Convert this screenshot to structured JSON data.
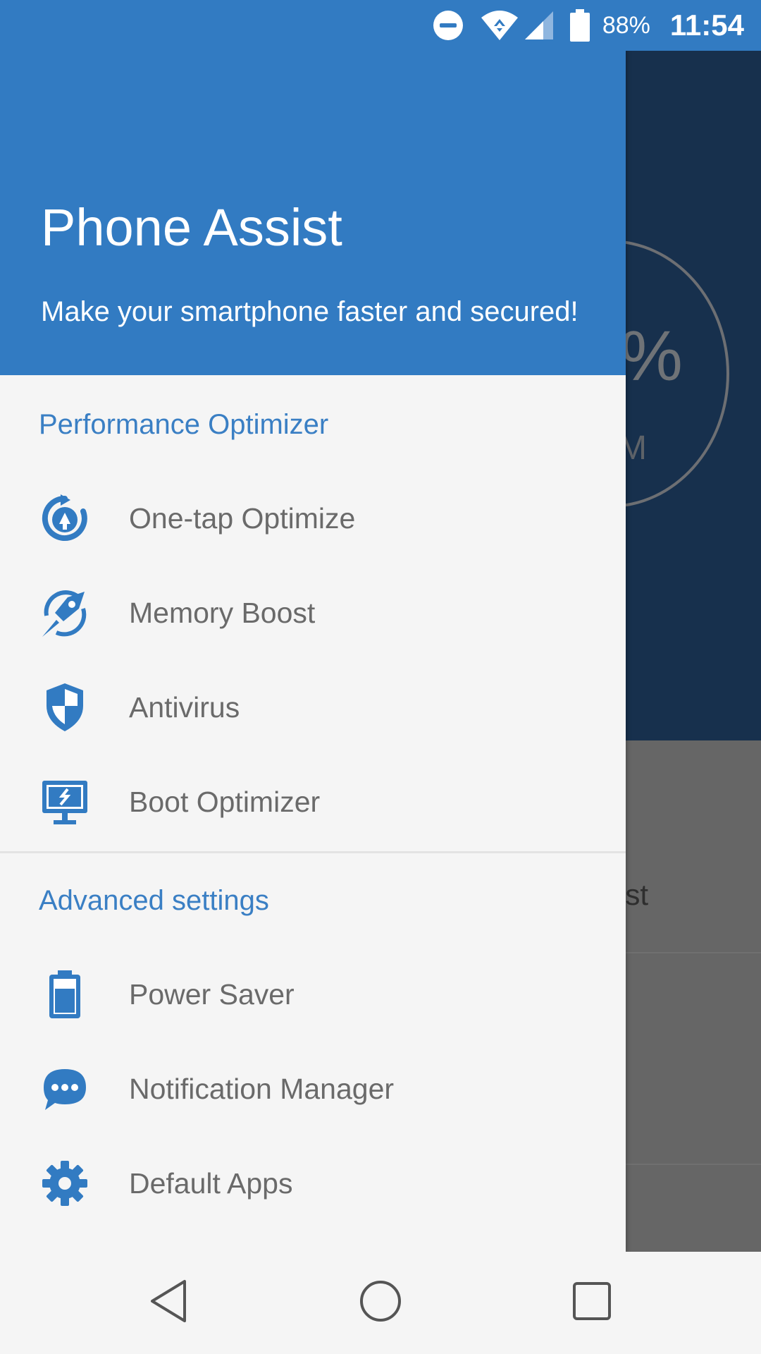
{
  "status_bar": {
    "battery_percent": "88%",
    "time": "11:54",
    "icons": [
      "do-not-disturb-icon",
      "wifi-icon",
      "cell-signal-icon",
      "battery-icon"
    ]
  },
  "background_app": {
    "ring_value_fragment": "%",
    "ring_unit_fragment": "M",
    "card_label_fragment": "ost"
  },
  "drawer": {
    "title": "Phone Assist",
    "subtitle": "Make your smartphone faster and secured!",
    "sections": [
      {
        "title": "Performance Optimizer",
        "items": [
          {
            "label": "One-tap Optimize",
            "icon": "optimize-icon"
          },
          {
            "label": "Memory Boost",
            "icon": "rocket-icon"
          },
          {
            "label": "Antivirus",
            "icon": "shield-icon"
          },
          {
            "label": "Boot Optimizer",
            "icon": "monitor-icon"
          }
        ]
      },
      {
        "title": "Advanced settings",
        "items": [
          {
            "label": "Power Saver",
            "icon": "battery-icon"
          },
          {
            "label": "Notification Manager",
            "icon": "chat-bubble-icon"
          },
          {
            "label": "Default Apps",
            "icon": "gear-icon"
          }
        ]
      }
    ]
  },
  "nav_bar": {
    "buttons": [
      "back-icon",
      "home-icon",
      "recents-icon"
    ]
  },
  "colors": {
    "accent": "#327bc2",
    "drawer_bg": "#f5f5f5",
    "label_text": "#6a6a6a",
    "background_dark": "#17304d",
    "scrim_gray": "#666666"
  }
}
